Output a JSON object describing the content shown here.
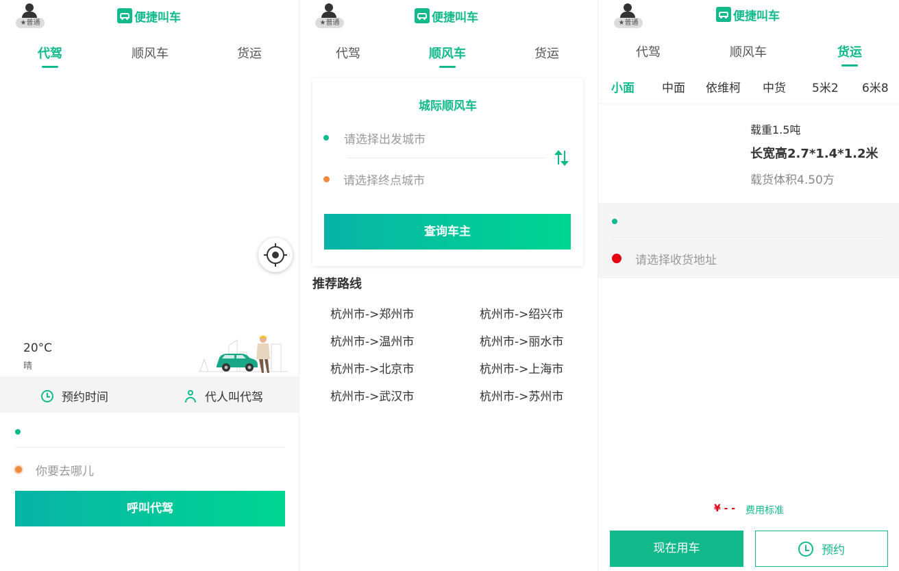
{
  "header": {
    "brand_title": "便捷叫车",
    "user_badge": "★普通"
  },
  "tabs": [
    "代驾",
    "顺风车",
    "货运"
  ],
  "panel1": {
    "active_tab": "代驾",
    "weather": {
      "temp": "20°C",
      "desc": "晴"
    },
    "options": {
      "schedule": "预约时间",
      "proxy": "代人叫代驾"
    },
    "start_value": "",
    "dest_placeholder": "你要去哪儿",
    "call_button": "呼叫代驾"
  },
  "panel2": {
    "active_tab": "顺风车",
    "card_title": "城际顺风车",
    "from_placeholder": "请选择出发城市",
    "to_placeholder": "请选择终点城市",
    "query_button": "查询车主",
    "recommend_title": "推荐路线",
    "routes": [
      "杭州市->郑州市",
      "杭州市->绍兴市",
      "杭州市->温州市",
      "杭州市->丽水市",
      "杭州市->北京市",
      "杭州市->上海市",
      "杭州市->武汉市",
      "杭州市->苏州市"
    ]
  },
  "panel3": {
    "active_tab": "货运",
    "vehicle_types": [
      "小面",
      "中面",
      "依维柯",
      "中货",
      "5米2",
      "6米8"
    ],
    "active_vehicle": "小面",
    "spec": {
      "load": "载重1.5吨",
      "dimensions": "长宽高2.7*1.4*1.2米",
      "volume": "载货体积4.50方"
    },
    "pickup_value": "",
    "receive_placeholder": "请选择收货地址",
    "price": "¥ - -",
    "fee_link": "费用标准",
    "now_button": "现在用车",
    "book_button": "预约"
  },
  "colors": {
    "accent": "#11b98b",
    "gradient_start": "#08b3a6",
    "gradient_end": "#00d692",
    "origin_dot": "#11b98b",
    "dest_dot": "#f08a3c",
    "receive_dot": "#e60012"
  },
  "icons": [
    "user-avatar-icon",
    "car-logo-icon",
    "locate-icon",
    "clock-icon",
    "person-icon",
    "swap-icon"
  ]
}
